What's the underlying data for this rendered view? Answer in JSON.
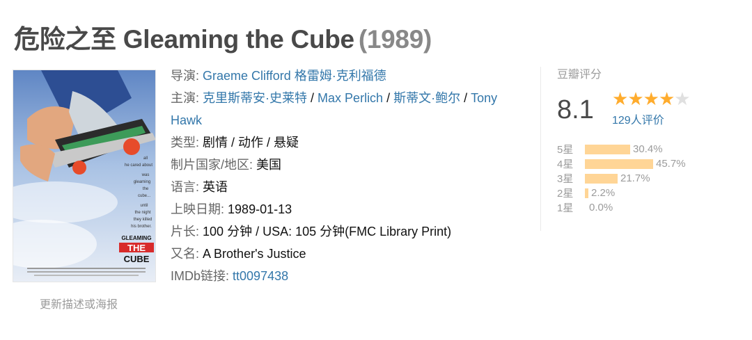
{
  "title": {
    "name": "危险之至 Gleaming the Cube",
    "year": "(1989)"
  },
  "poster": {
    "tagline": [
      "all",
      "he cared about",
      "was",
      "gleaming",
      "the",
      "cube...",
      "until",
      "the night",
      "they killed",
      "his brother."
    ],
    "logo_top": "GLEAMING",
    "logo_mid": "THE",
    "logo_bottom": "CUBE"
  },
  "update_link": "更新描述或海报",
  "info": {
    "director_label": "导演:",
    "director": "Graeme Clifford 格雷姆·克利福德",
    "cast_label": "主演:",
    "cast": [
      "克里斯蒂安·史莱特",
      "Max Perlich",
      "斯蒂文·鲍尔",
      "Tony Hawk"
    ],
    "genre_label": "类型:",
    "genre": "剧情 / 动作 / 悬疑",
    "country_label": "制片国家/地区:",
    "country": "美国",
    "language_label": "语言:",
    "language": "英语",
    "release_label": "上映日期:",
    "release": "1989-01-13",
    "runtime_label": "片长:",
    "runtime": "100 分钟 / USA: 105 分钟(FMC Library Print)",
    "aka_label": "又名:",
    "aka": "A Brother's Justice",
    "imdb_label": "IMDb链接:",
    "imdb": "tt0097438"
  },
  "rating": {
    "label": "豆瓣评分",
    "score": "8.1",
    "stars_filled": 4,
    "stars_total": 5,
    "votes": "129人评价",
    "distribution": [
      {
        "label": "5星",
        "percent": "30.4%",
        "value": 30.4
      },
      {
        "label": "4星",
        "percent": "45.7%",
        "value": 45.7
      },
      {
        "label": "3星",
        "percent": "21.7%",
        "value": 21.7
      },
      {
        "label": "2星",
        "percent": "2.2%",
        "value": 2.2
      },
      {
        "label": "1星",
        "percent": "0.0%",
        "value": 0.0
      }
    ]
  },
  "colors": {
    "link": "#3377aa",
    "star": "#ffac2d",
    "bar": "#ffd596",
    "muted": "#9b9b9b"
  }
}
